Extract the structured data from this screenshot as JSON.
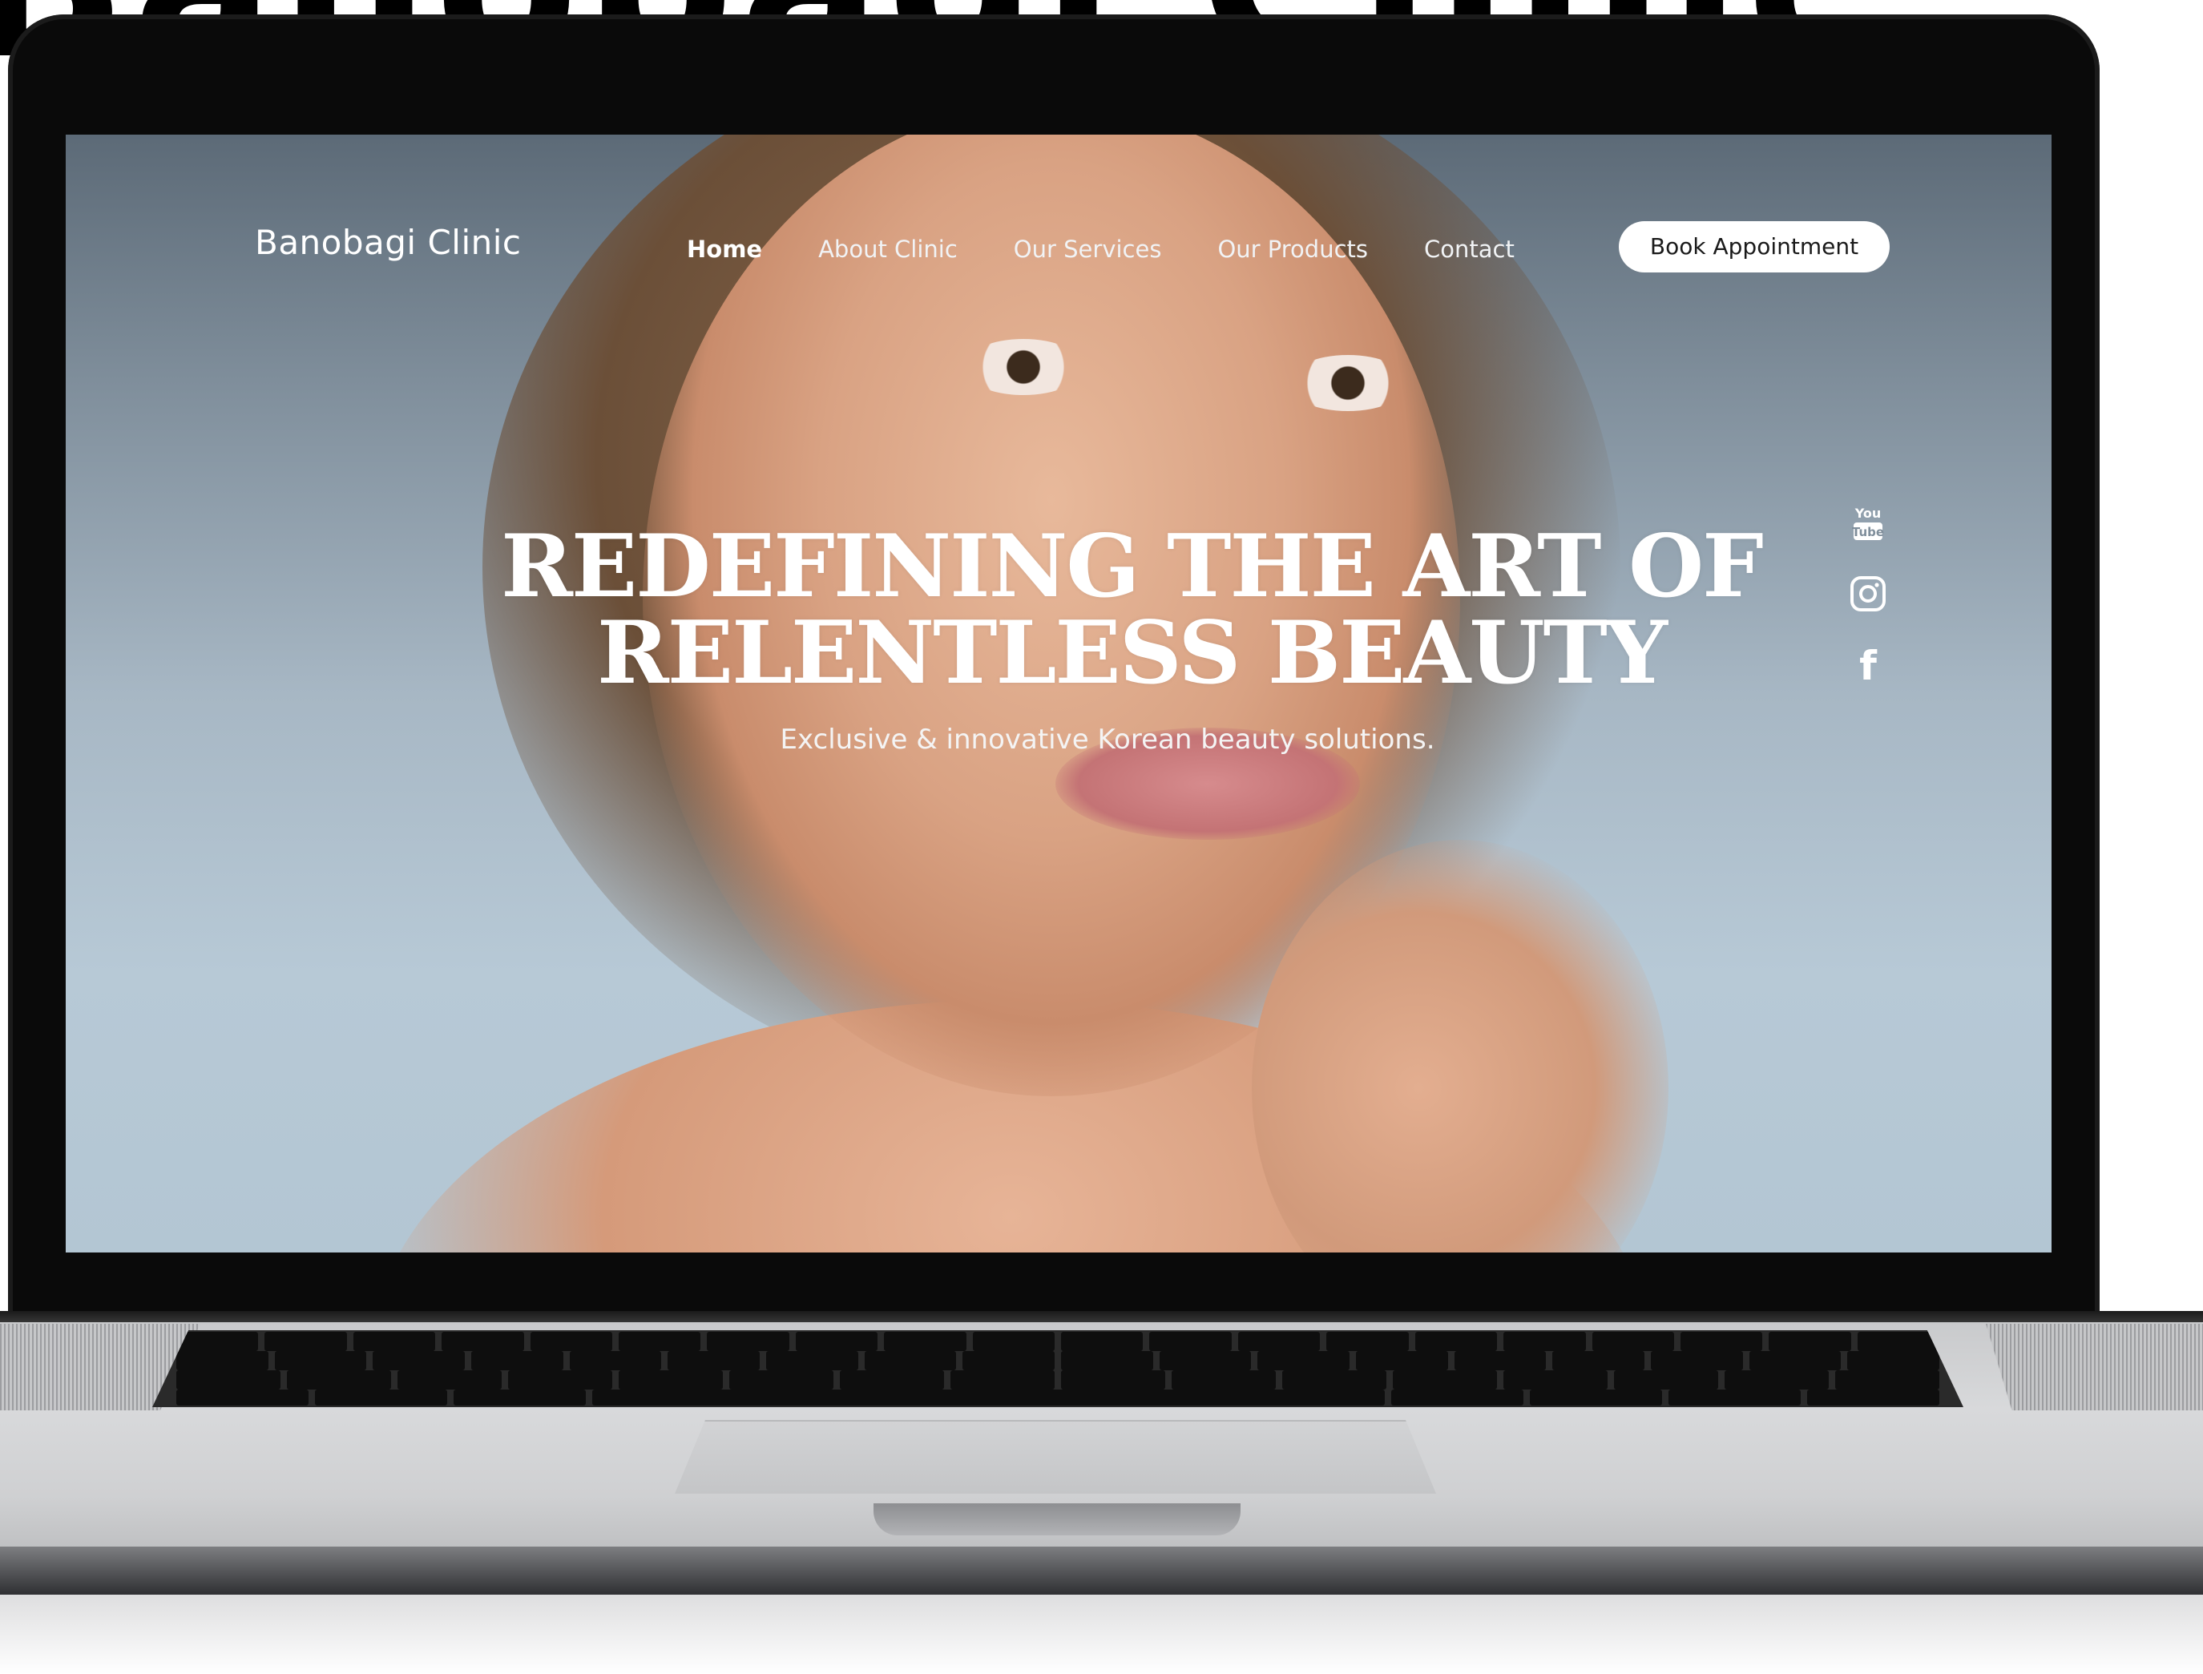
{
  "banner": {
    "text": "Banobagi Clinic"
  },
  "site": {
    "logo": "Banobagi Clinic",
    "nav": [
      {
        "label": "Home",
        "active": true
      },
      {
        "label": "About Clinic",
        "active": false
      },
      {
        "label": "Our Services",
        "active": false
      },
      {
        "label": "Our Products",
        "active": false
      },
      {
        "label": "Contact",
        "active": false
      }
    ],
    "cta_label": "Book Appointment"
  },
  "hero": {
    "title_line1": "REDEFINING THE ART OF",
    "title_line2": "RELENTLESS BEAUTY",
    "subtitle": "Exclusive & innovative Korean beauty solutions."
  },
  "social": [
    {
      "icon": "youtube-icon",
      "glyph_top": "You",
      "glyph_bottom": "Tube"
    },
    {
      "icon": "instagram-icon"
    },
    {
      "icon": "facebook-icon",
      "glyph": "f"
    }
  ],
  "colors": {
    "screen_top": "#5c6a77",
    "screen_bottom": "#b3c6d3",
    "text": "#ffffff",
    "button_bg": "#ffffff",
    "button_text": "#1a1a1a"
  }
}
